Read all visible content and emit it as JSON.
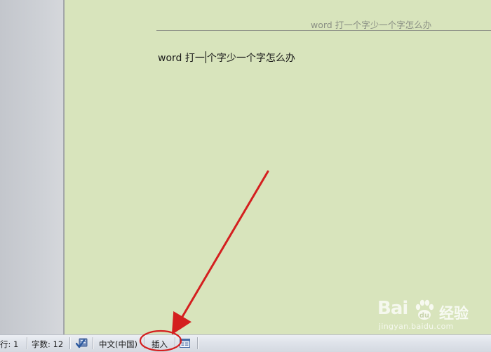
{
  "document": {
    "header_text": "word 打一个字少一个字怎么办",
    "body_before_cursor": "word 打一",
    "body_after_cursor": "个字少一个字怎么办"
  },
  "status_bar": {
    "line": "行: 1",
    "word_count": "字数: 12",
    "proofing_icon": "proofing-check-icon",
    "language": "中文(中国)",
    "insert_mode": "插入",
    "view_icon": "macro-record-icon"
  },
  "watermark": {
    "logo": "Bai",
    "brand": "经验",
    "url": "jingyan.baidu.com"
  },
  "colors": {
    "page_background": "#d8e4bc",
    "annotation_red": "#d41f1f"
  }
}
